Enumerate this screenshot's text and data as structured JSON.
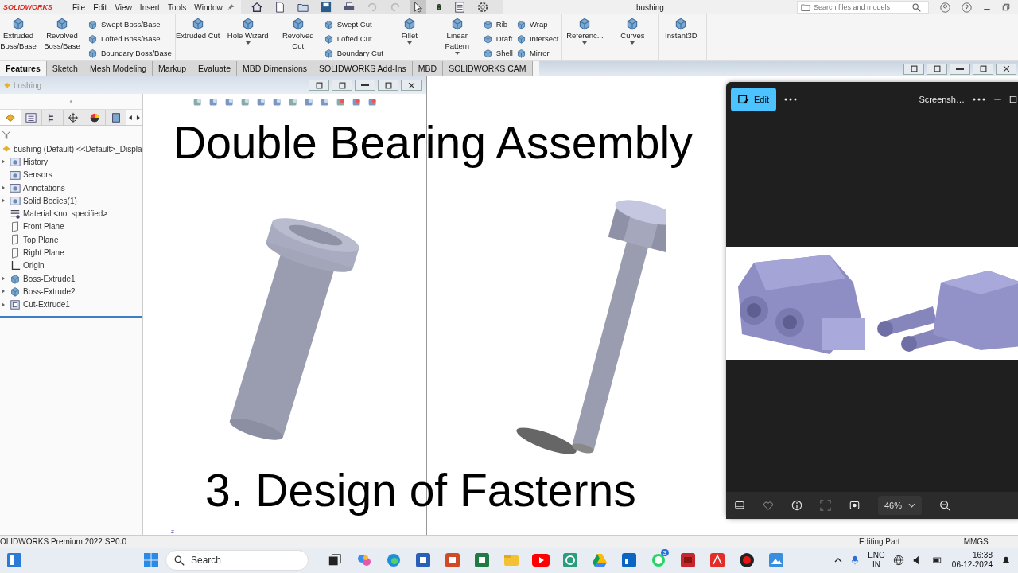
{
  "title_bar": {
    "logo": "SOLIDWORKS",
    "menu": [
      "File",
      "Edit",
      "View",
      "Insert",
      "Tools",
      "Window"
    ],
    "document_title": "bushing",
    "search": {
      "placeholder": "Search files and models"
    }
  },
  "ribbon": [
    {
      "items": [
        {
          "kind": "large",
          "label": "Extruded Boss/Base",
          "dropdown": false
        },
        {
          "kind": "large",
          "label": "Revolved Boss/Base",
          "dropdown": false
        },
        {
          "kind": "stack",
          "items": [
            "Swept Boss/Base",
            "Lofted Boss/Base",
            "Boundary Boss/Base"
          ]
        }
      ]
    },
    {
      "items": [
        {
          "kind": "large",
          "label": "Extruded Cut",
          "dropdown": false
        },
        {
          "kind": "large",
          "label": "Hole Wizard",
          "dropdown": true
        },
        {
          "kind": "large",
          "label": "Revolved Cut",
          "dropdown": false
        },
        {
          "kind": "stack",
          "items": [
            "Swept Cut",
            "Lofted Cut",
            "Boundary Cut"
          ]
        }
      ]
    },
    {
      "items": [
        {
          "kind": "large",
          "label": "Fillet",
          "dropdown": true
        },
        {
          "kind": "large",
          "label": "Linear Pattern",
          "dropdown": true
        },
        {
          "kind": "stack",
          "items": [
            "Rib",
            "Draft",
            "Shell"
          ]
        },
        {
          "kind": "stack",
          "items": [
            "Wrap",
            "Intersect",
            "Mirror"
          ]
        }
      ]
    },
    {
      "items": [
        {
          "kind": "large",
          "label": "Referenc...",
          "dropdown": true
        },
        {
          "kind": "large",
          "label": "Curves",
          "dropdown": true
        }
      ]
    },
    {
      "items": [
        {
          "kind": "large",
          "label": "Instant3D",
          "dropdown": false
        }
      ]
    }
  ],
  "command_tabs": [
    {
      "label": "Features",
      "selected": true
    },
    {
      "label": "Sketch",
      "selected": false
    },
    {
      "label": "Mesh Modeling",
      "selected": false
    },
    {
      "label": "Markup",
      "selected": false
    },
    {
      "label": "Evaluate",
      "selected": false
    },
    {
      "label": "MBD Dimensions",
      "selected": false
    },
    {
      "label": "SOLIDWORKS Add-Ins",
      "selected": false
    },
    {
      "label": "MBD",
      "selected": false
    },
    {
      "label": "SOLIDWORKS CAM",
      "selected": false
    }
  ],
  "document_window": {
    "title": "bushing"
  },
  "panel_tabs": [
    {
      "kind": "features",
      "selected": true
    },
    {
      "kind": "properties",
      "selected": false
    },
    {
      "kind": "configurations",
      "selected": false
    },
    {
      "kind": "origin",
      "selected": false
    },
    {
      "kind": "appearance",
      "selected": false
    },
    {
      "kind": "display",
      "selected": false
    }
  ],
  "tree": {
    "label": "bushing (Default) <<Default>_Displa",
    "children": [
      {
        "label": "History",
        "kind": "folder",
        "expandable": true
      },
      {
        "label": "Sensors",
        "kind": "folder",
        "expandable": false
      },
      {
        "label": "Annotations",
        "kind": "folder",
        "expandable": true
      },
      {
        "label": "Solid Bodies(1)",
        "kind": "folder",
        "expandable": true
      },
      {
        "label": "Material <not specified>",
        "kind": "material",
        "expandable": false
      },
      {
        "label": "Front Plane",
        "kind": "plane",
        "expandable": false
      },
      {
        "label": "Top Plane",
        "kind": "plane",
        "expandable": false
      },
      {
        "label": "Right Plane",
        "kind": "plane",
        "expandable": false
      },
      {
        "label": "Origin",
        "kind": "origin",
        "expandable": false
      },
      {
        "label": "Boss-Extrude1",
        "kind": "feature",
        "expandable": true
      },
      {
        "label": "Boss-Extrude2",
        "kind": "feature",
        "expandable": true
      },
      {
        "label": "Cut-Extrude1",
        "kind": "cut",
        "expandable": true
      }
    ]
  },
  "viewport": {
    "triad_label": "z"
  },
  "overlay": {
    "heading": "Double Bearing Assembly",
    "subheading": "3. Design of Fasterns"
  },
  "photo_viewer": {
    "edit_label": "Edit",
    "title": "Screensh…",
    "zoom": "46%"
  },
  "status_bar": {
    "product": "OLIDWORKS Premium 2022 SP0.0",
    "mode": "Editing Part",
    "units": "MMGS"
  },
  "taskbar": {
    "search": "Search",
    "apps": [
      {
        "kind": "taskview"
      },
      {
        "kind": "copilot"
      },
      {
        "kind": "edge"
      },
      {
        "kind": "word"
      },
      {
        "kind": "powerpoint"
      },
      {
        "kind": "excel"
      },
      {
        "kind": "explorer"
      },
      {
        "kind": "youtube"
      },
      {
        "kind": "chatgpt"
      },
      {
        "kind": "drive"
      },
      {
        "kind": "linkedin"
      },
      {
        "kind": "whatsapp",
        "badge": "3"
      },
      {
        "kind": "solidworks"
      },
      {
        "kind": "acrobat"
      },
      {
        "kind": "record"
      },
      {
        "kind": "photos"
      }
    ],
    "language": "ENG",
    "region": "IN",
    "time": "16:38",
    "date": "06-12-2024"
  }
}
